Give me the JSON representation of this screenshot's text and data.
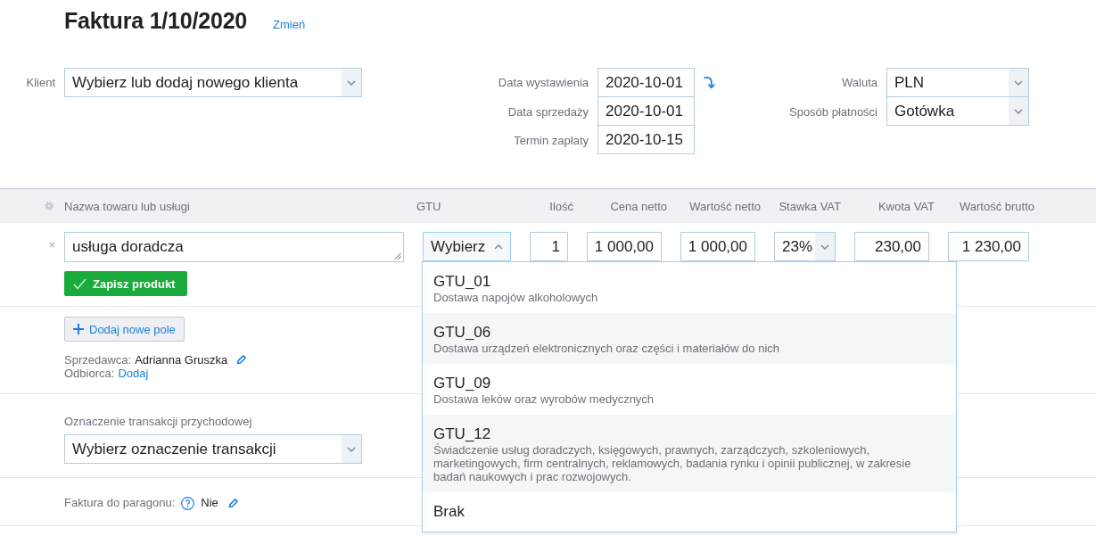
{
  "invoice_header": {
    "title": "Faktura 1/10/2020",
    "change_link": "Zmień"
  },
  "client": {
    "label": "Klient",
    "value": "Wybierz lub dodaj nowego klienta"
  },
  "dates": [
    {
      "label": "Data wystawienia",
      "value": "2020-10-01"
    },
    {
      "label": "Data sprzedaży",
      "value": "2020-10-01"
    },
    {
      "label": "Termin zapłaty",
      "value": "2020-10-15"
    }
  ],
  "currency": {
    "label": "Waluta",
    "value": "PLN"
  },
  "payment_method": {
    "label": "Sposób płatności",
    "value": "Gotówka"
  },
  "items_table": {
    "columns": [
      "Nazwa towaru lub usługi",
      "GTU",
      "Ilość",
      "Cena netto",
      "Wartość netto",
      "Stawka VAT",
      "Kwota VAT",
      "Wartość brutto"
    ],
    "row": [
      {
        "kind": "textarea",
        "value": "usługa doradcza"
      },
      {
        "kind": "select",
        "value": "Wybierz",
        "expanded": true,
        "options": [
          {
            "code": "GTU_01",
            "description": "Dostawa napojów alkoholowych"
          },
          {
            "code": "GTU_06",
            "description": "Dostawa urządzeń elektronicznych oraz części i materiałów do nich"
          },
          {
            "code": "GTU_09",
            "description": "Dostawa leków oraz wyrobów medycznych"
          },
          {
            "code": "GTU_12",
            "description": "Świadczenie usług doradczych, księgowych, prawnych, zarządczych, szkoleniowych, marketingowych, firm centralnych, reklamowych, badania rynku i opinii publicznej, w zakresie badań naukowych i prac rozwojowych."
          },
          {
            "code": "Brak"
          }
        ]
      },
      {
        "kind": "input",
        "value": "1"
      },
      {
        "kind": "input",
        "value": "1 000,00"
      },
      {
        "kind": "input",
        "value": "1 000,00"
      },
      {
        "kind": "select",
        "value": "23%",
        "expanded": false
      },
      {
        "kind": "input",
        "value": "230,00"
      },
      {
        "kind": "input",
        "value": "1 230,00"
      }
    ],
    "save_button": "Zapisz produkt"
  },
  "add_field_button": "Dodaj nowe pole",
  "seller": {
    "label": "Sprzedawca:",
    "value": "Adrianna Gruszka"
  },
  "recipient": {
    "label": "Odbiorca:",
    "link": "Dodaj"
  },
  "transaction_mark": {
    "label": "Oznaczenie transakcji przychodowej",
    "value": "Wybierz oznaczenie transakcji"
  },
  "receipt_invoice": {
    "label": "Faktura do paragonu:",
    "value": "Nie"
  }
}
